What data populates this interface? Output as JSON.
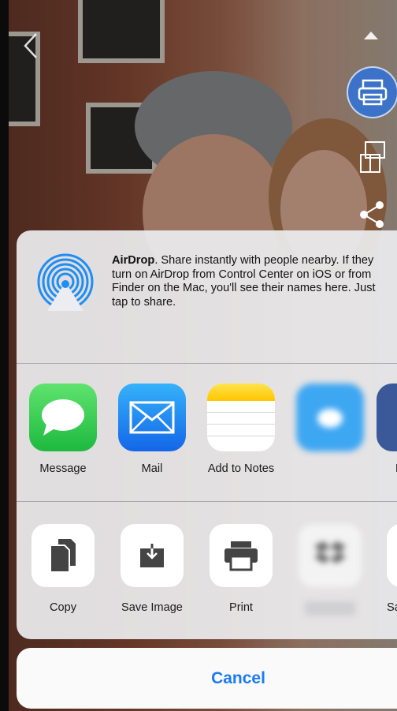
{
  "airdrop": {
    "title": "AirDrop",
    "description": ". Share instantly with people nearby. If they turn on AirDrop from Control Center on iOS or from Finder on the Mac, you'll see their names here. Just tap to share."
  },
  "apps": [
    {
      "label": "Message",
      "icon": "message-icon",
      "color": "#34c759"
    },
    {
      "label": "Mail",
      "icon": "mail-icon",
      "color": "#1e8ef5"
    },
    {
      "label": "Add to Notes",
      "icon": "notes-icon",
      "color": "#ffd200"
    },
    {
      "label": "",
      "icon": "twitter-icon",
      "color": "#3ea7f2"
    },
    {
      "label": "F",
      "icon": "partial-app-icon",
      "color": "#3b5998"
    }
  ],
  "actions": [
    {
      "label": "Copy",
      "icon": "copy-icon"
    },
    {
      "label": "Save Image",
      "icon": "save-image-icon"
    },
    {
      "label": "Print",
      "icon": "print-icon"
    },
    {
      "label": "",
      "icon": "dropbox-icon"
    },
    {
      "label": "Sa",
      "icon": "partial-action-icon"
    }
  ],
  "cancel_label": "Cancel",
  "colors": {
    "accent": "#1a7bf2",
    "airdrop_blue": "#1f8ef1",
    "print_circle": "#3c73c8"
  }
}
